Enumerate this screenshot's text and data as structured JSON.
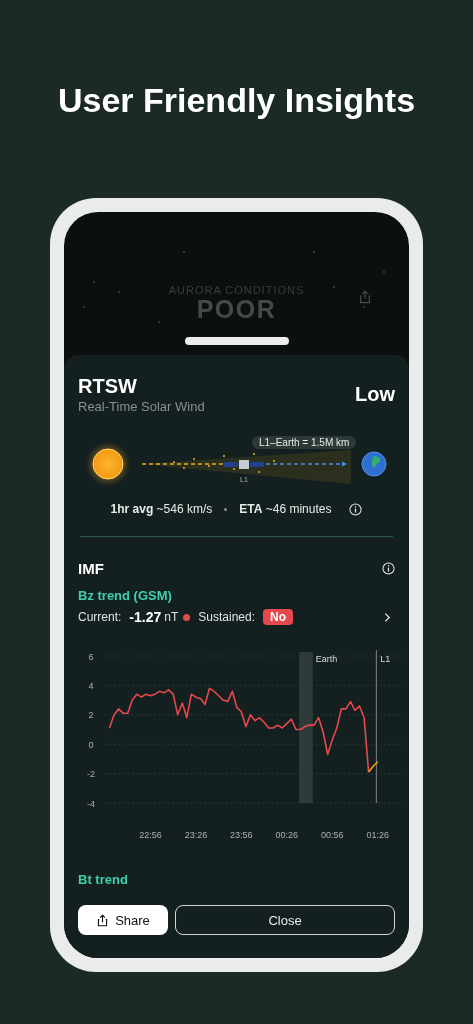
{
  "headline": "User Friendly Insights",
  "background_screen": {
    "label": "AURORA CONDITIONS",
    "value": "POOR"
  },
  "sheet": {
    "title": "RTSW",
    "subtitle": "Real-Time Solar Wind",
    "level_label": "Low",
    "diagram": {
      "distance_label": "L1–Earth = 1.5M km",
      "point_label": "L1"
    },
    "stats": [
      {
        "text": "**1hr avg** ~546 km/s"
      },
      {
        "text": "**ETA** ~46 minutes"
      }
    ],
    "imf": {
      "title": "IMF",
      "subtitle": "Bz trend (GSM)",
      "current_label": "Current:",
      "current_value": "-1.27",
      "current_unit": "nT",
      "status_dot": {
        "color": "#e5484d"
      },
      "sustained_label": "Sustained:",
      "sustained_value": "No",
      "chart_data": {
        "type": "line",
        "categories": [
          null,
          null,
          null,
          null,
          null,
          null,
          null,
          null,
          null,
          "22:56",
          null,
          null,
          null,
          null,
          null,
          null,
          null,
          null,
          null,
          "23:26",
          null,
          null,
          null,
          null,
          null,
          null,
          null,
          null,
          null,
          "23:56",
          null,
          null,
          null,
          null,
          null,
          null,
          null,
          null,
          null,
          "00:26",
          null,
          null,
          null,
          null,
          null,
          null,
          null,
          null,
          null,
          "00:56",
          null,
          null,
          null,
          null,
          null,
          null,
          null,
          null,
          null,
          "01:26"
        ],
        "ylim": [
          -4,
          6
        ],
        "grid": true,
        "yticks": [
          -4,
          -2,
          0,
          2,
          4,
          6
        ],
        "series": [
          {
            "color": "#e5484d",
            "values": [
              1.1,
              2.0,
              2.4,
              2.1,
              2.1,
              3.0,
              3.4,
              3.2,
              3.4,
              3.3,
              3.4,
              3.6,
              3.5,
              3.7,
              3.4,
              2.0,
              2.8,
              1.8,
              3.4,
              3.2,
              3.1,
              2.7,
              3.8,
              3.6,
              3.3,
              3.0,
              2.9,
              3.6,
              2.5,
              2.2,
              1.2,
              2.0,
              1.6,
              1.8,
              1.5,
              1.1,
              1.1,
              1.3,
              1.1,
              1.4,
              1.7,
              1.0,
              1.0,
              1.2,
              1.3,
              1.3,
              1.8,
              0.8,
              -0.7,
              0.3,
              1.1,
              2.4,
              2.4,
              2.9,
              2.3,
              2.6,
              1.8,
              -1.9,
              null,
              null
            ]
          },
          {
            "color": "#f59e0b",
            "values": [
              null,
              null,
              null,
              null,
              null,
              null,
              null,
              null,
              null,
              null,
              null,
              null,
              null,
              null,
              null,
              null,
              null,
              null,
              null,
              null,
              null,
              null,
              null,
              null,
              null,
              null,
              null,
              null,
              null,
              null,
              null,
              null,
              null,
              null,
              null,
              null,
              null,
              null,
              null,
              null,
              null,
              null,
              null,
              null,
              null,
              null,
              null,
              null,
              null,
              null,
              null,
              null,
              null,
              null,
              null,
              null,
              null,
              -1.9,
              -1.5,
              -1.2
            ]
          }
        ]
      },
      "chart_markers": [
        {
          "kind": "band",
          "label": "Earth"
        },
        {
          "kind": "line",
          "label": "L1"
        }
      ]
    },
    "next_section": "Bt trend"
  },
  "buttons": [
    {
      "label": "Share",
      "kind": "primary"
    },
    {
      "label": "Close",
      "kind": "secondary"
    }
  ]
}
